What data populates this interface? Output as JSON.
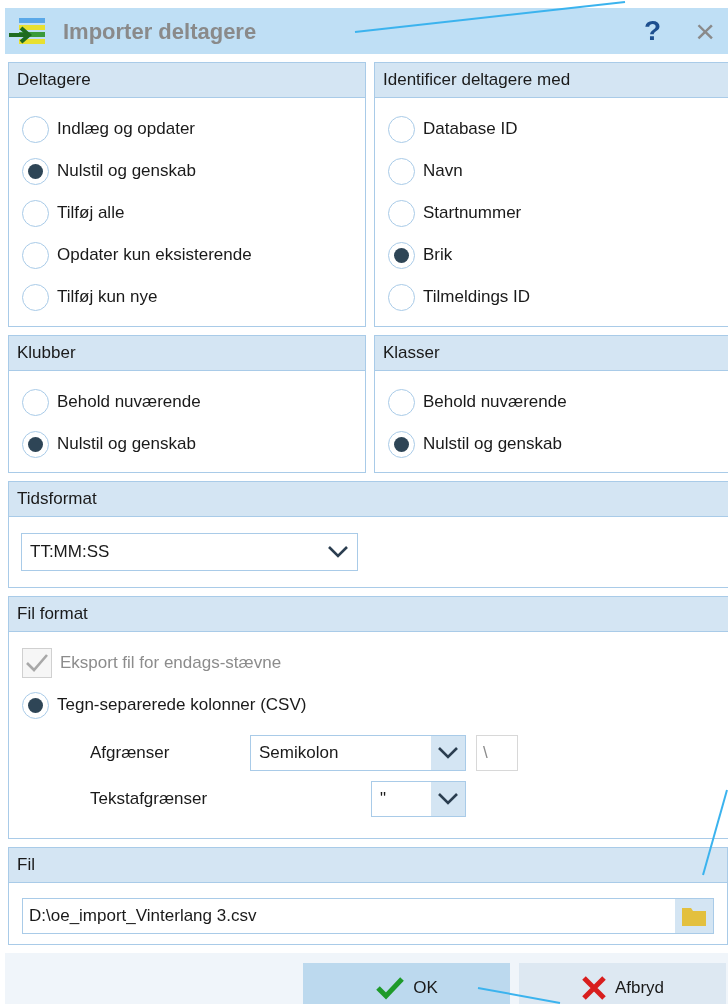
{
  "title_bar": {
    "title": "Importer deltagere",
    "help": "?",
    "close": "×"
  },
  "participants": {
    "title": "Deltagere",
    "options": [
      {
        "label": "Indlæg og opdater",
        "selected": false
      },
      {
        "label": "Nulstil og genskab",
        "selected": true
      },
      {
        "label": "Tilføj alle",
        "selected": false
      },
      {
        "label": "Opdater kun eksisterende",
        "selected": false
      },
      {
        "label": "Tilføj kun nye",
        "selected": false
      }
    ]
  },
  "identify": {
    "title": "Identificer deltagere med",
    "options": [
      {
        "label": "Database ID",
        "selected": false
      },
      {
        "label": "Navn",
        "selected": false
      },
      {
        "label": "Startnummer",
        "selected": false
      },
      {
        "label": "Brik",
        "selected": true
      },
      {
        "label": "Tilmeldings ID",
        "selected": false
      }
    ]
  },
  "clubs": {
    "title": "Klubber",
    "options": [
      {
        "label": "Behold nuværende",
        "selected": false
      },
      {
        "label": "Nulstil og genskab",
        "selected": true
      }
    ]
  },
  "classes": {
    "title": "Klasser",
    "options": [
      {
        "label": "Behold nuværende",
        "selected": false
      },
      {
        "label": "Nulstil og genskab",
        "selected": true
      }
    ]
  },
  "time_format": {
    "title": "Tidsformat",
    "value": "TT:MM:SS"
  },
  "file_format": {
    "title": "Fil format",
    "export_checkbox": {
      "label": "Eksport fil for endags-stævne",
      "checked": true,
      "disabled": true
    },
    "csv_option": {
      "label": "Tegn-separerede kolonner (CSV)",
      "selected": true
    },
    "delimiter": {
      "label": "Afgrænser",
      "value": "Semikolon",
      "extra_value": "\\"
    },
    "text_delimiter": {
      "label": "Tekstafgrænser",
      "value": "\""
    }
  },
  "file": {
    "title": "Fil",
    "path": "D:\\oe_import_Vinterlang 3.csv"
  },
  "buttons": [
    {
      "label": "OK",
      "kind": "ok",
      "selected": true
    },
    {
      "label": "Afbryd",
      "kind": "cancel",
      "selected": false
    }
  ]
}
